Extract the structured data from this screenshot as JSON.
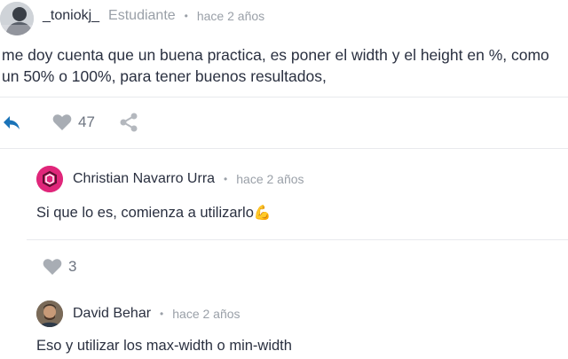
{
  "comment": {
    "author": "_toniokj_",
    "role": "Estudiante",
    "separator": "•",
    "time": "hace 2 años",
    "text": "me doy cuenta que un buena practica, es poner el width y el height en %, como un 50% o 100%, para tener buenos resultados,",
    "likes": "47",
    "icons": {
      "reply": "reply-arrow-icon",
      "like": "heart-icon",
      "share": "share-icon"
    },
    "colors": {
      "reply": "#1a73b8",
      "icon_gray": "#a8adb4"
    }
  },
  "replies": [
    {
      "author": "Christian Navarro Urra",
      "separator": "•",
      "time": "hace 2 años",
      "text": "Si que lo es, comienza a utilizarlo",
      "emoji": "💪",
      "likes": "3",
      "avatar_color": "#e0267a"
    },
    {
      "author": "David Behar",
      "separator": "•",
      "time": "hace 2 años",
      "text": "Eso y utilizar los max-width o min-width"
    }
  ]
}
